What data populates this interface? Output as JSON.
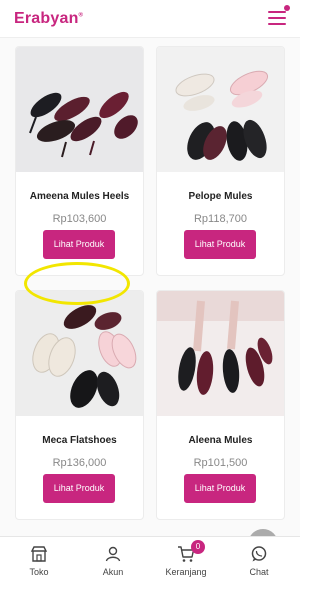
{
  "header": {
    "brand": "Erabyan",
    "brand_mark": "®",
    "menu_icon": "hamburger-icon"
  },
  "products": [
    {
      "name": "Ameena Mules Heels",
      "price": "Rp103,600",
      "button_label": "Lihat Produk"
    },
    {
      "name": "Pelope Mules",
      "price": "Rp118,700",
      "button_label": "Lihat Produk"
    },
    {
      "name": "Meca Flatshoes",
      "price": "Rp136,000",
      "button_label": "Lihat Produk"
    },
    {
      "name": "Aleena Mules",
      "price": "Rp101,500",
      "button_label": "Lihat Produk"
    }
  ],
  "bottom_nav": {
    "items": [
      {
        "label": "Toko",
        "icon": "store-icon"
      },
      {
        "label": "Akun",
        "icon": "user-icon"
      },
      {
        "label": "Keranjang",
        "icon": "cart-icon",
        "badge": "0"
      },
      {
        "label": "Chat",
        "icon": "chat-icon"
      }
    ]
  },
  "colors": {
    "accent": "#c8267f",
    "highlight": "#f2e600"
  }
}
